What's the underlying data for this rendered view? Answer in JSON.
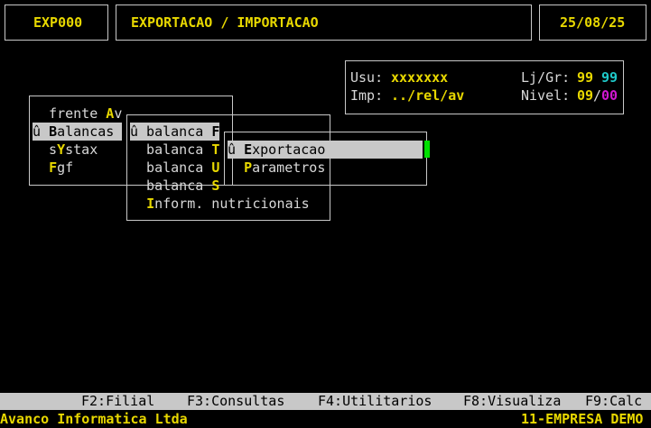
{
  "header": {
    "program": "EXP000",
    "title": "EXPORTACAO / IMPORTACAO",
    "date": "25/08/25"
  },
  "info": {
    "usu_label": "Usu:",
    "usu_value": "xxxxxxx",
    "ljgr_label": "Lj/Gr:",
    "lj_value": "99",
    "gr_value": "99",
    "imp_label": "Imp:",
    "imp_value": "../rel/av",
    "nivel_label": "Nivel:",
    "nivel_a": "09",
    "nivel_sep": "/",
    "nivel_b": "00"
  },
  "menu1": {
    "items": [
      {
        "pre": "  frente ",
        "hk": "A",
        "post": "v",
        "selected": false
      },
      {
        "pre": "û ",
        "hk": "B",
        "post": "alancas",
        "selected": true
      },
      {
        "pre": "  s",
        "hk": "Y",
        "post": "stax",
        "selected": false
      },
      {
        "pre": "  ",
        "hk": "F",
        "post": "gf",
        "selected": false
      }
    ]
  },
  "menu2": {
    "items": [
      {
        "pre": "û balanca ",
        "hk": "F",
        "post": "",
        "selected": true
      },
      {
        "pre": "  balanca ",
        "hk": "T",
        "post": "",
        "selected": false
      },
      {
        "pre": "  balanca ",
        "hk": "U",
        "post": "",
        "selected": false
      },
      {
        "pre": "  balanca ",
        "hk": "S",
        "post": "",
        "selected": false
      },
      {
        "pre": "  ",
        "hk": "I",
        "post": "nform. nutricionais",
        "selected": false
      }
    ]
  },
  "menu3": {
    "items": [
      {
        "pre": "û ",
        "hk": "E",
        "post": "xportacao",
        "selected": true
      },
      {
        "pre": "  ",
        "hk": "P",
        "post": "arametros",
        "selected": false
      }
    ]
  },
  "fkeys": [
    "F2:Filial",
    "F3:Consultas",
    "F4:Utilitarios",
    "F8:Visualiza",
    "F9:Calc"
  ],
  "footer": {
    "company": "Avanco Informatica Ltda",
    "empresa": "11-EMPRESA DEMO"
  }
}
